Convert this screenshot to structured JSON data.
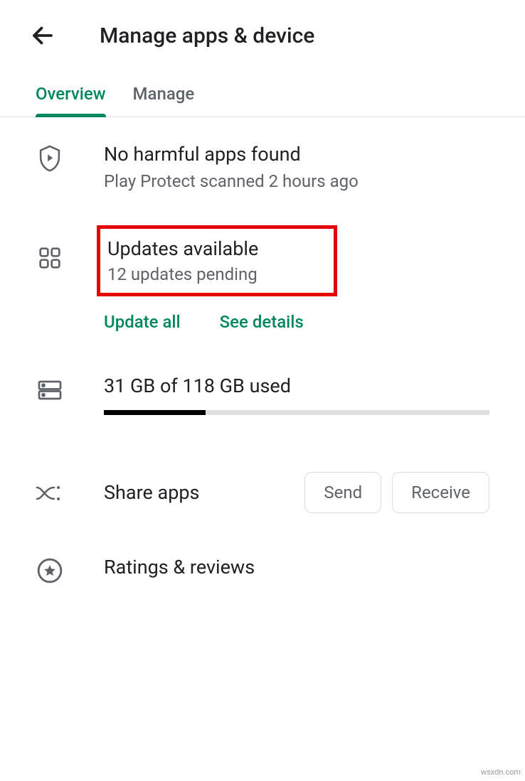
{
  "header": {
    "title": "Manage apps & device"
  },
  "tabs": [
    {
      "label": "Overview",
      "active": true
    },
    {
      "label": "Manage",
      "active": false
    }
  ],
  "protect": {
    "title": "No harmful apps found",
    "subtitle": "Play Protect scanned 2 hours ago"
  },
  "updates": {
    "title": "Updates available",
    "subtitle": "12 updates pending",
    "update_all_label": "Update all",
    "see_details_label": "See details"
  },
  "storage": {
    "title": "31 GB of 118 GB used",
    "used_percent": 26.3
  },
  "share": {
    "title": "Share apps",
    "send_label": "Send",
    "receive_label": "Receive"
  },
  "ratings": {
    "title": "Ratings & reviews"
  },
  "watermark": "wsxdn.com"
}
